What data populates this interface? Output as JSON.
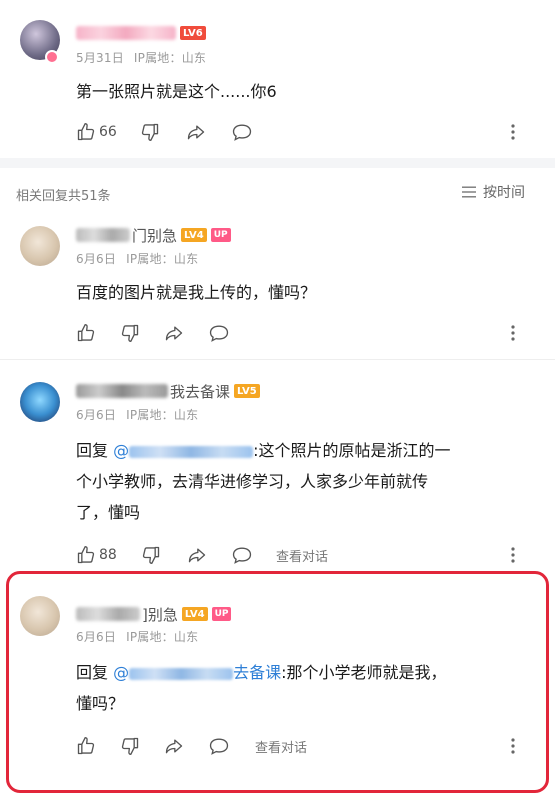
{
  "top_comment": {
    "badge": "LV6",
    "date": "5月31日",
    "location": "IP属地：山东",
    "text": "第一张照片就是这个......你6",
    "likes": "66"
  },
  "replies_header": {
    "count_label": "相关回复共51条",
    "sort_label": "按时间"
  },
  "replies": [
    {
      "name_visible": "门别急",
      "level": "LV4",
      "up_badge": "UP",
      "date": "6月6日",
      "location": "IP属地：山东",
      "text": "百度的图片就是我上传的，懂吗？",
      "likes": ""
    },
    {
      "name_visible": "我去备课",
      "level": "LV5",
      "date": "6月6日",
      "location": "IP属地：山东",
      "reply_prefix": "回复",
      "mention_at": "@",
      "text_line1": ":这个照片的原帖是浙江的一",
      "text_line2": "个小学教师，去清华进修学习，人家多少年前就传",
      "text_line3": "了，懂吗",
      "likes": "88",
      "view_thread": "查看对话"
    },
    {
      "name_visible": "]别急",
      "level": "LV4",
      "up_badge": "UP",
      "date": "6月6日",
      "location": "IP属地：山东",
      "reply_prefix": "回复",
      "mention_at": "@",
      "mention_visible": "去备课",
      "text_line1": ":那个小学老师就是我，",
      "text_line2": "懂吗？",
      "view_thread": "查看对话"
    }
  ],
  "colors": {
    "accent_blue": "#2e7fd6",
    "highlight_red": "#e2263a",
    "level_orange": "#f5a623",
    "level_red": "#f04c3c",
    "up_pink": "#ff5a87"
  },
  "icons": [
    "thumb-up-icon",
    "thumb-down-icon",
    "share-icon",
    "comment-icon",
    "more-vertical-icon",
    "sort-list-icon"
  ]
}
